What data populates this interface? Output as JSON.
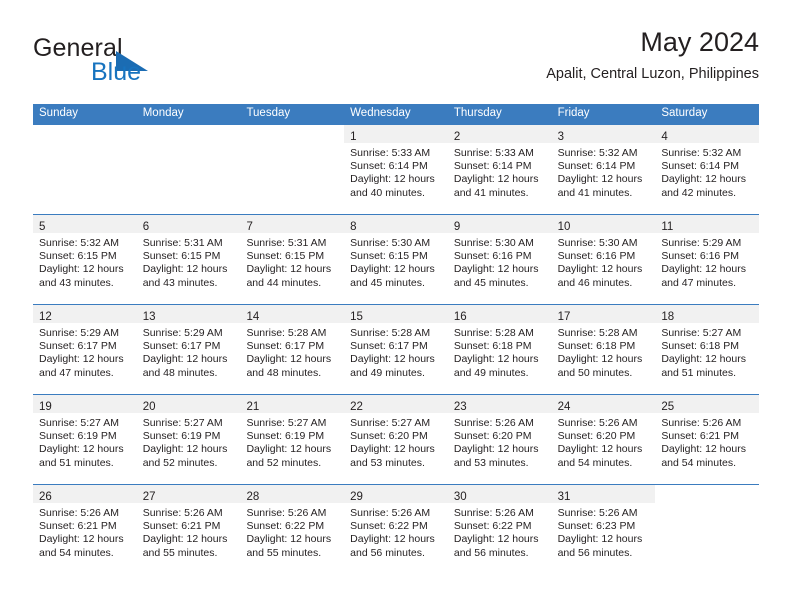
{
  "brand": {
    "name_part1": "General",
    "name_part2": "Blue",
    "accent_color": "#1773bf",
    "triangle_color": "#1b6cb3"
  },
  "header": {
    "title": "May 2024",
    "subtitle": "Apalit, Central Luzon, Philippines"
  },
  "calendar": {
    "header_bg": "#3b7cbf",
    "day_band_bg": "#f1f1f1",
    "weekdays": [
      "Sunday",
      "Monday",
      "Tuesday",
      "Wednesday",
      "Thursday",
      "Friday",
      "Saturday"
    ],
    "weeks": [
      [
        {
          "day": "",
          "blank": true,
          "lines": []
        },
        {
          "day": "",
          "blank": true,
          "lines": []
        },
        {
          "day": "",
          "blank": true,
          "lines": []
        },
        {
          "day": "1",
          "lines": [
            "Sunrise: 5:33 AM",
            "Sunset: 6:14 PM",
            "Daylight: 12 hours",
            "and 40 minutes."
          ]
        },
        {
          "day": "2",
          "lines": [
            "Sunrise: 5:33 AM",
            "Sunset: 6:14 PM",
            "Daylight: 12 hours",
            "and 41 minutes."
          ]
        },
        {
          "day": "3",
          "lines": [
            "Sunrise: 5:32 AM",
            "Sunset: 6:14 PM",
            "Daylight: 12 hours",
            "and 41 minutes."
          ]
        },
        {
          "day": "4",
          "lines": [
            "Sunrise: 5:32 AM",
            "Sunset: 6:14 PM",
            "Daylight: 12 hours",
            "and 42 minutes."
          ]
        }
      ],
      [
        {
          "day": "5",
          "lines": [
            "Sunrise: 5:32 AM",
            "Sunset: 6:15 PM",
            "Daylight: 12 hours",
            "and 43 minutes."
          ]
        },
        {
          "day": "6",
          "lines": [
            "Sunrise: 5:31 AM",
            "Sunset: 6:15 PM",
            "Daylight: 12 hours",
            "and 43 minutes."
          ]
        },
        {
          "day": "7",
          "lines": [
            "Sunrise: 5:31 AM",
            "Sunset: 6:15 PM",
            "Daylight: 12 hours",
            "and 44 minutes."
          ]
        },
        {
          "day": "8",
          "lines": [
            "Sunrise: 5:30 AM",
            "Sunset: 6:15 PM",
            "Daylight: 12 hours",
            "and 45 minutes."
          ]
        },
        {
          "day": "9",
          "lines": [
            "Sunrise: 5:30 AM",
            "Sunset: 6:16 PM",
            "Daylight: 12 hours",
            "and 45 minutes."
          ]
        },
        {
          "day": "10",
          "lines": [
            "Sunrise: 5:30 AM",
            "Sunset: 6:16 PM",
            "Daylight: 12 hours",
            "and 46 minutes."
          ]
        },
        {
          "day": "11",
          "lines": [
            "Sunrise: 5:29 AM",
            "Sunset: 6:16 PM",
            "Daylight: 12 hours",
            "and 47 minutes."
          ]
        }
      ],
      [
        {
          "day": "12",
          "lines": [
            "Sunrise: 5:29 AM",
            "Sunset: 6:17 PM",
            "Daylight: 12 hours",
            "and 47 minutes."
          ]
        },
        {
          "day": "13",
          "lines": [
            "Sunrise: 5:29 AM",
            "Sunset: 6:17 PM",
            "Daylight: 12 hours",
            "and 48 minutes."
          ]
        },
        {
          "day": "14",
          "lines": [
            "Sunrise: 5:28 AM",
            "Sunset: 6:17 PM",
            "Daylight: 12 hours",
            "and 48 minutes."
          ]
        },
        {
          "day": "15",
          "lines": [
            "Sunrise: 5:28 AM",
            "Sunset: 6:17 PM",
            "Daylight: 12 hours",
            "and 49 minutes."
          ]
        },
        {
          "day": "16",
          "lines": [
            "Sunrise: 5:28 AM",
            "Sunset: 6:18 PM",
            "Daylight: 12 hours",
            "and 49 minutes."
          ]
        },
        {
          "day": "17",
          "lines": [
            "Sunrise: 5:28 AM",
            "Sunset: 6:18 PM",
            "Daylight: 12 hours",
            "and 50 minutes."
          ]
        },
        {
          "day": "18",
          "lines": [
            "Sunrise: 5:27 AM",
            "Sunset: 6:18 PM",
            "Daylight: 12 hours",
            "and 51 minutes."
          ]
        }
      ],
      [
        {
          "day": "19",
          "lines": [
            "Sunrise: 5:27 AM",
            "Sunset: 6:19 PM",
            "Daylight: 12 hours",
            "and 51 minutes."
          ]
        },
        {
          "day": "20",
          "lines": [
            "Sunrise: 5:27 AM",
            "Sunset: 6:19 PM",
            "Daylight: 12 hours",
            "and 52 minutes."
          ]
        },
        {
          "day": "21",
          "lines": [
            "Sunrise: 5:27 AM",
            "Sunset: 6:19 PM",
            "Daylight: 12 hours",
            "and 52 minutes."
          ]
        },
        {
          "day": "22",
          "lines": [
            "Sunrise: 5:27 AM",
            "Sunset: 6:20 PM",
            "Daylight: 12 hours",
            "and 53 minutes."
          ]
        },
        {
          "day": "23",
          "lines": [
            "Sunrise: 5:26 AM",
            "Sunset: 6:20 PM",
            "Daylight: 12 hours",
            "and 53 minutes."
          ]
        },
        {
          "day": "24",
          "lines": [
            "Sunrise: 5:26 AM",
            "Sunset: 6:20 PM",
            "Daylight: 12 hours",
            "and 54 minutes."
          ]
        },
        {
          "day": "25",
          "lines": [
            "Sunrise: 5:26 AM",
            "Sunset: 6:21 PM",
            "Daylight: 12 hours",
            "and 54 minutes."
          ]
        }
      ],
      [
        {
          "day": "26",
          "lines": [
            "Sunrise: 5:26 AM",
            "Sunset: 6:21 PM",
            "Daylight: 12 hours",
            "and 54 minutes."
          ]
        },
        {
          "day": "27",
          "lines": [
            "Sunrise: 5:26 AM",
            "Sunset: 6:21 PM",
            "Daylight: 12 hours",
            "and 55 minutes."
          ]
        },
        {
          "day": "28",
          "lines": [
            "Sunrise: 5:26 AM",
            "Sunset: 6:22 PM",
            "Daylight: 12 hours",
            "and 55 minutes."
          ]
        },
        {
          "day": "29",
          "lines": [
            "Sunrise: 5:26 AM",
            "Sunset: 6:22 PM",
            "Daylight: 12 hours",
            "and 56 minutes."
          ]
        },
        {
          "day": "30",
          "lines": [
            "Sunrise: 5:26 AM",
            "Sunset: 6:22 PM",
            "Daylight: 12 hours",
            "and 56 minutes."
          ]
        },
        {
          "day": "31",
          "lines": [
            "Sunrise: 5:26 AM",
            "Sunset: 6:23 PM",
            "Daylight: 12 hours",
            "and 56 minutes."
          ]
        },
        {
          "day": "",
          "blank": true,
          "lines": []
        }
      ]
    ]
  }
}
